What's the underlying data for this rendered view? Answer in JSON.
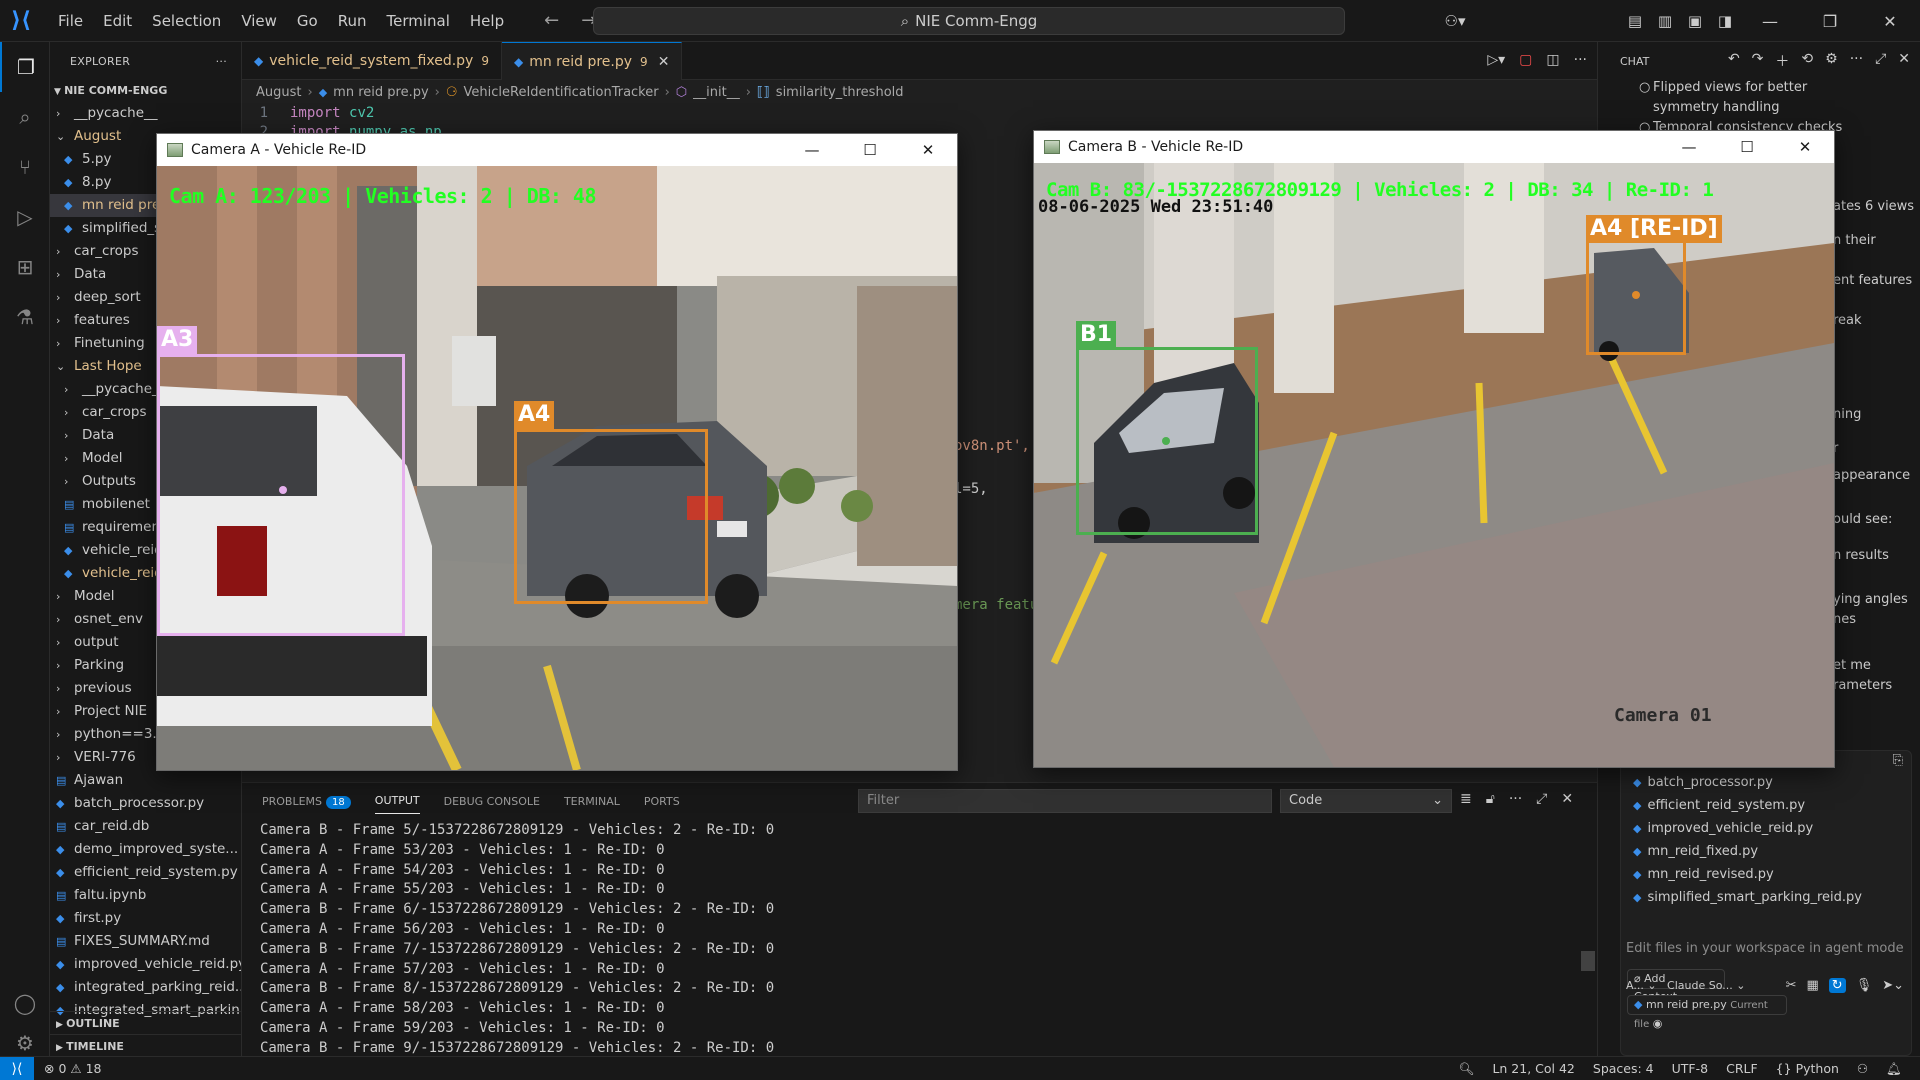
{
  "titlebar": {
    "menu": [
      "File",
      "Edit",
      "Selection",
      "View",
      "Go",
      "Run",
      "Terminal",
      "Help"
    ],
    "search": "NIE Comm-Engg"
  },
  "explorer": {
    "title": "EXPLORER",
    "root": "NIE COMM-ENGG",
    "items": [
      {
        "label": "__pycache__",
        "type": "folder",
        "depth": 1,
        "open": false
      },
      {
        "label": "August",
        "type": "folder",
        "depth": 1,
        "open": true,
        "modified": true
      },
      {
        "label": "5.py",
        "type": "py",
        "depth": 2
      },
      {
        "label": "8.py",
        "type": "py",
        "depth": 2
      },
      {
        "label": "mn reid pre.py",
        "type": "py",
        "depth": 2,
        "selected": true,
        "modified": true
      },
      {
        "label": "simplified_smart_parking_reid.py",
        "type": "py",
        "depth": 2
      },
      {
        "label": "car_crops",
        "type": "folder",
        "depth": 1,
        "open": false
      },
      {
        "label": "Data",
        "type": "folder",
        "depth": 1,
        "open": false
      },
      {
        "label": "deep_sort",
        "type": "folder",
        "depth": 1,
        "open": false
      },
      {
        "label": "features",
        "type": "folder",
        "depth": 1,
        "open": false
      },
      {
        "label": "Finetuning",
        "type": "folder",
        "depth": 1,
        "open": false
      },
      {
        "label": "Last Hope",
        "type": "folder",
        "depth": 1,
        "open": true,
        "modified": true
      },
      {
        "label": "__pycache__",
        "type": "folder",
        "depth": 2,
        "open": false
      },
      {
        "label": "car_crops",
        "type": "folder",
        "depth": 2,
        "open": false
      },
      {
        "label": "Data",
        "type": "folder",
        "depth": 2,
        "open": false
      },
      {
        "label": "Model",
        "type": "folder",
        "depth": 2,
        "open": false
      },
      {
        "label": "Outputs",
        "type": "folder",
        "depth": 2,
        "open": false
      },
      {
        "label": "mobilenet",
        "type": "file",
        "depth": 2
      },
      {
        "label": "requirements.txt",
        "type": "file",
        "depth": 2
      },
      {
        "label": "vehicle_reid",
        "type": "py",
        "depth": 2
      },
      {
        "label": "vehicle_reid",
        "type": "py",
        "depth": 2,
        "modified": true
      },
      {
        "label": "Model",
        "type": "folder",
        "depth": 1,
        "open": false
      },
      {
        "label": "osnet_env",
        "type": "folder",
        "depth": 1,
        "open": false
      },
      {
        "label": "output",
        "type": "folder",
        "depth": 1,
        "open": false
      },
      {
        "label": "Parking",
        "type": "folder",
        "depth": 1,
        "open": false
      },
      {
        "label": "previous",
        "type": "folder",
        "depth": 1,
        "open": false
      },
      {
        "label": "Project NIE",
        "type": "folder",
        "depth": 1,
        "open": false
      },
      {
        "label": "python==3.",
        "type": "folder",
        "depth": 1,
        "open": false
      },
      {
        "label": "VERI-776",
        "type": "folder",
        "depth": 1,
        "open": false
      },
      {
        "label": "Ajawan",
        "type": "file",
        "depth": 1
      },
      {
        "label": "batch_processor.py",
        "type": "py",
        "depth": 1
      },
      {
        "label": "car_reid.db",
        "type": "file",
        "depth": 1
      },
      {
        "label": "demo_improved_syste...",
        "type": "py",
        "depth": 1
      },
      {
        "label": "efficient_reid_system.py",
        "type": "py",
        "depth": 1
      },
      {
        "label": "faltu.ipynb",
        "type": "file",
        "depth": 1
      },
      {
        "label": "first.py",
        "type": "py",
        "depth": 1
      },
      {
        "label": "FIXES_SUMMARY.md",
        "type": "file",
        "depth": 1
      },
      {
        "label": "improved_vehicle_reid.py",
        "type": "py",
        "depth": 1
      },
      {
        "label": "integrated_parking_reid....",
        "type": "py",
        "depth": 1
      },
      {
        "label": "integrated_smart_parkin...",
        "type": "py",
        "depth": 1
      }
    ],
    "outline": "OUTLINE",
    "timeline": "TIMELINE"
  },
  "editor": {
    "tabs": [
      {
        "label": "vehicle_reid_system_fixed.py",
        "badge": "9",
        "active": false
      },
      {
        "label": "mn reid pre.py",
        "badge": "9",
        "active": true
      }
    ],
    "breadcrumb": [
      "August",
      "mn reid pre.py",
      "VehicleReIdentificationTracker",
      "__init__",
      "similarity_threshold"
    ],
    "lines": [
      {
        "n": "1",
        "kw": "import",
        "name": "cv2"
      },
      {
        "n": "2",
        "kw": "import",
        "name": "numpy as np"
      }
    ],
    "fragments": [
      "ov8n.pt',",
      "l=5,",
      "mera featu"
    ]
  },
  "camA": {
    "title": "Camera A - Vehicle Re-ID",
    "hud": "Cam A: 123/203 | Vehicles: 2 | DB: 48",
    "boxes": [
      {
        "label": "A3",
        "color": "#e6b0ee"
      },
      {
        "label": "A4",
        "color": "#e08a2a"
      }
    ]
  },
  "camB": {
    "title": "Camera B - Vehicle Re-ID",
    "hud": "Cam B: 83/-1537228672809129 | Vehicles: 2 | DB: 34 | Re-ID: 1",
    "timestamp": "08-06-2025 Wed 23:51:40",
    "watermark": "Camera 01",
    "boxes": [
      {
        "label": "B1",
        "color": "#4caf50"
      },
      {
        "label": "A4 [RE-ID]",
        "color": "#e08a2a"
      }
    ]
  },
  "panel": {
    "tabs": [
      "PROBLEMS",
      "OUTPUT",
      "DEBUG CONSOLE",
      "TERMINAL",
      "PORTS"
    ],
    "problems_count": "18",
    "filter_placeholder": "Filter",
    "channel": "Code",
    "lines": [
      "Camera B - Frame 5/-1537228672809129 - Vehicles: 2 - Re-ID: 0",
      "Camera A - Frame 53/203 - Vehicles: 1 - Re-ID: 0",
      "Camera A - Frame 54/203 - Vehicles: 1 - Re-ID: 0",
      "Camera A - Frame 55/203 - Vehicles: 1 - Re-ID: 0",
      "Camera B - Frame 6/-1537228672809129 - Vehicles: 2 - Re-ID: 0",
      "Camera A - Frame 56/203 - Vehicles: 1 - Re-ID: 0",
      "Camera B - Frame 7/-1537228672809129 - Vehicles: 2 - Re-ID: 0",
      "Camera A - Frame 57/203 - Vehicles: 1 - Re-ID: 0",
      "Camera B - Frame 8/-1537228672809129 - Vehicles: 2 - Re-ID: 0",
      "Camera A - Frame 58/203 - Vehicles: 1 - Re-ID: 0",
      "Camera A - Frame 59/203 - Vehicles: 1 - Re-ID: 0",
      "Camera B - Frame 9/-1537228672809129 - Vehicles: 2 - Re-ID: 0"
    ]
  },
  "chat": {
    "title": "CHAT",
    "bullets": [
      "Flipped views for better symmetry handling",
      "Temporal consistency checks"
    ],
    "partial_lines": [
      "ates 6 views",
      "n their",
      "ent features",
      "reak",
      "ning",
      "r",
      "appearance",
      "ould see:",
      "n results",
      "ying angles",
      "nes",
      "et me",
      "rameters"
    ],
    "context_files": [
      "batch_processor.py",
      "efficient_reid_system.py",
      "improved_vehicle_reid.py",
      "mn_reid_fixed.py",
      "mn_reid_revised.py",
      "simplified_smart_parking_reid.py"
    ],
    "add_context": "Add Context...",
    "current_file": "mn reid pre.py",
    "current_file_tag": "Current file",
    "input_placeholder": "Edit files in your workspace in agent mode",
    "mode": "A...",
    "model": "Claude So..."
  },
  "statusbar": {
    "errors": "0",
    "warnings": "18",
    "position": "Ln 21, Col 42",
    "spaces": "Spaces: 4",
    "encoding": "UTF-8",
    "eol": "CRLF",
    "language": "Python"
  }
}
